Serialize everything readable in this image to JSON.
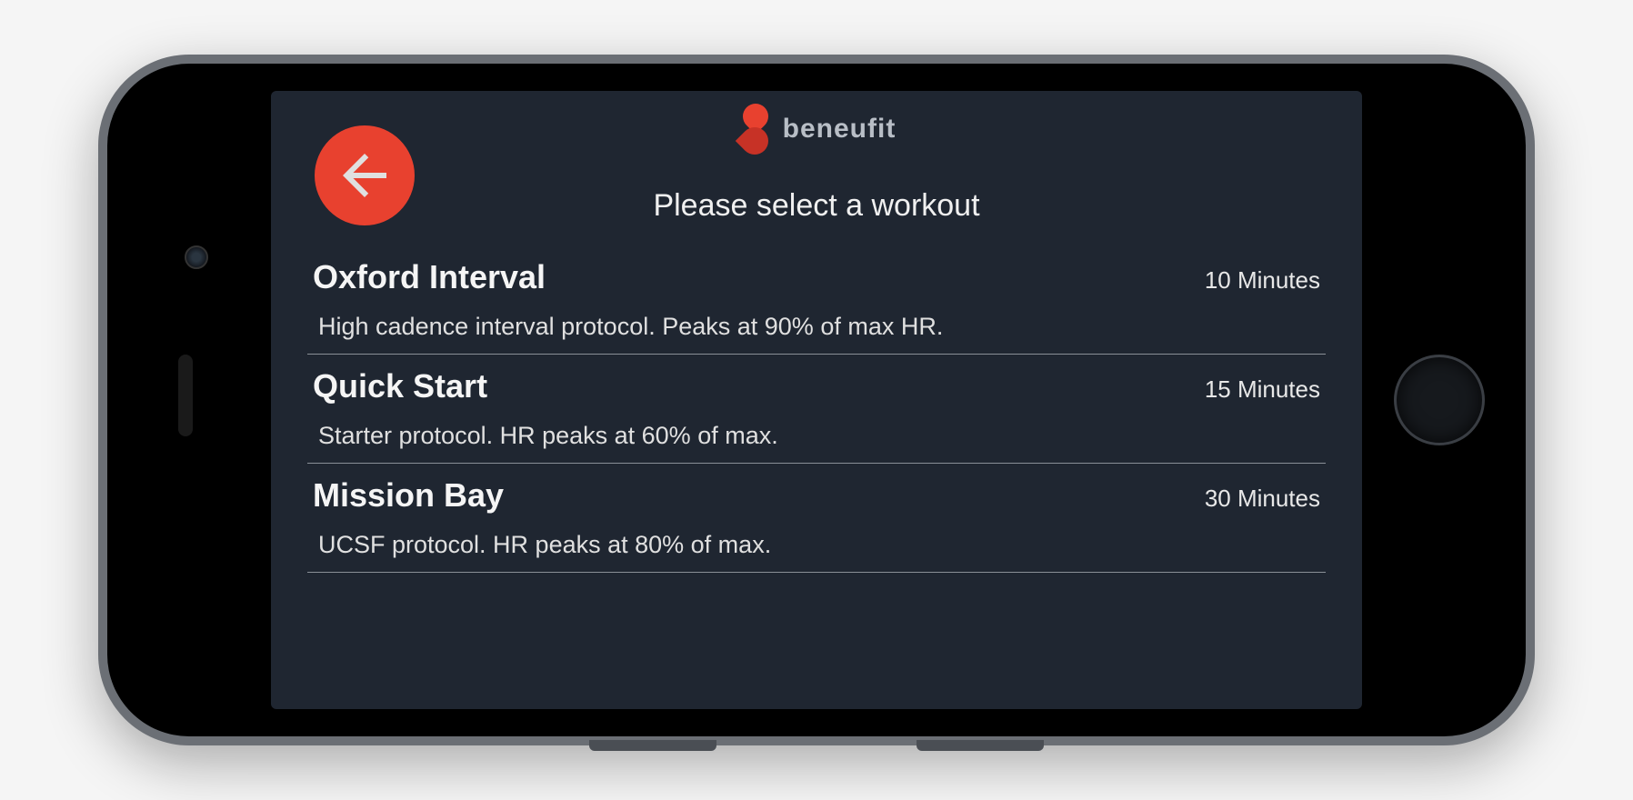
{
  "header": {
    "brand": "beneufit",
    "back_icon": "arrow-left",
    "accent_color": "#e8412f"
  },
  "page_title": "Please select a workout",
  "workouts": [
    {
      "name": "Oxford Interval",
      "duration": "10 Minutes",
      "description": "High cadence interval protocol. Peaks at 90% of max HR."
    },
    {
      "name": "Quick Start",
      "duration": "15 Minutes",
      "description": "Starter protocol. HR peaks at 60% of max."
    },
    {
      "name": "Mission Bay",
      "duration": "30 Minutes",
      "description": "UCSF protocol. HR peaks at 80% of max."
    }
  ]
}
